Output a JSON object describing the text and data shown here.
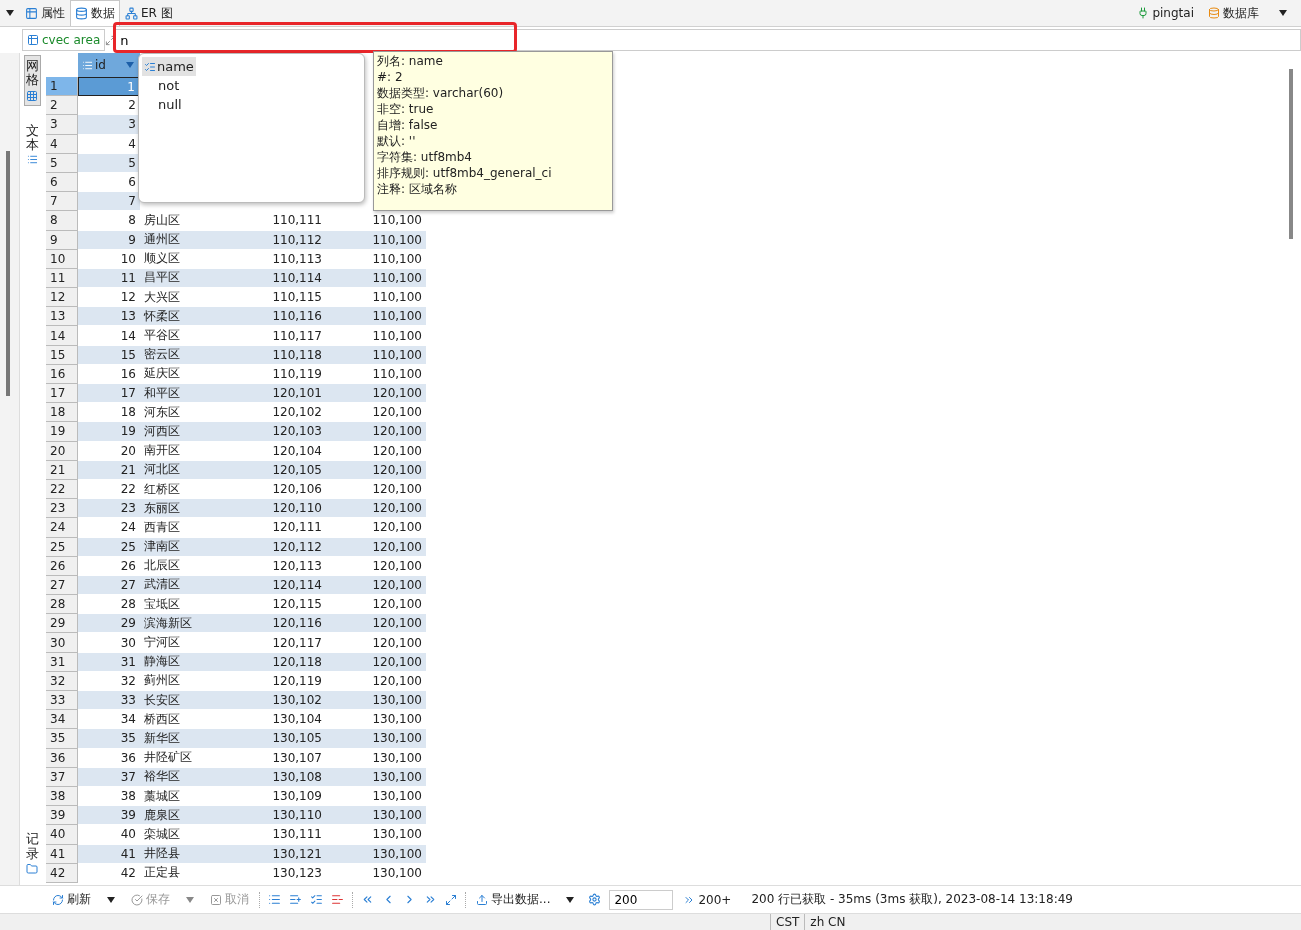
{
  "tabs": [
    {
      "label": "属性",
      "selected": false,
      "kind": "props"
    },
    {
      "label": "数据",
      "selected": true,
      "kind": "data"
    },
    {
      "label": "ER 图",
      "selected": false,
      "kind": "er"
    }
  ],
  "connection": {
    "datasource": "pingtai",
    "database": "数据库"
  },
  "filter": {
    "table": "cvec area",
    "value": "n",
    "highlighted": true
  },
  "side_tabs": [
    {
      "label": "网格",
      "selected": true,
      "kind": "grid"
    },
    {
      "label": "文本",
      "selected": false,
      "kind": "text"
    },
    {
      "label": "记录",
      "selected": false,
      "kind": "record"
    }
  ],
  "table": {
    "columns": [
      {
        "label": "id",
        "sorted": true
      }
    ],
    "rows": [
      {
        "row_number": "1",
        "id": "1",
        "selected": true
      },
      {
        "row_number": "2",
        "id": "2",
        "selected": false
      },
      {
        "row_number": "3",
        "id": "3",
        "selected": false
      },
      {
        "row_number": "4",
        "id": "4",
        "selected": false
      },
      {
        "row_number": "5",
        "id": "5",
        "selected": false
      },
      {
        "row_number": "6",
        "id": "6",
        "selected": false
      },
      {
        "row_number": "7",
        "id": "7",
        "selected": false
      },
      {
        "row_number": "8",
        "id": "8",
        "name": "房山区",
        "column_3": "110,111",
        "column_4": "110,100",
        "selected": false
      },
      {
        "row_number": "9",
        "id": "9",
        "name": "通州区",
        "column_3": "110,112",
        "column_4": "110,100",
        "selected": false
      },
      {
        "row_number": "10",
        "id": "10",
        "name": "顺义区",
        "column_3": "110,113",
        "column_4": "110,100",
        "selected": false
      },
      {
        "row_number": "11",
        "id": "11",
        "name": "昌平区",
        "column_3": "110,114",
        "column_4": "110,100",
        "selected": false
      },
      {
        "row_number": "12",
        "id": "12",
        "name": "大兴区",
        "column_3": "110,115",
        "column_4": "110,100",
        "selected": false
      },
      {
        "row_number": "13",
        "id": "13",
        "name": "怀柔区",
        "column_3": "110,116",
        "column_4": "110,100",
        "selected": false
      },
      {
        "row_number": "14",
        "id": "14",
        "name": "平谷区",
        "column_3": "110,117",
        "column_4": "110,100",
        "selected": false
      },
      {
        "row_number": "15",
        "id": "15",
        "name": "密云区",
        "column_3": "110,118",
        "column_4": "110,100",
        "selected": false
      },
      {
        "row_number": "16",
        "id": "16",
        "name": "延庆区",
        "column_3": "110,119",
        "column_4": "110,100",
        "selected": false
      },
      {
        "row_number": "17",
        "id": "17",
        "name": "和平区",
        "column_3": "120,101",
        "column_4": "120,100",
        "selected": false
      },
      {
        "row_number": "18",
        "id": "18",
        "name": "河东区",
        "column_3": "120,102",
        "column_4": "120,100",
        "selected": false
      },
      {
        "row_number": "19",
        "id": "19",
        "name": "河西区",
        "column_3": "120,103",
        "column_4": "120,100",
        "selected": false
      },
      {
        "row_number": "20",
        "id": "20",
        "name": "南开区",
        "column_3": "120,104",
        "column_4": "120,100",
        "selected": false
      },
      {
        "row_number": "21",
        "id": "21",
        "name": "河北区",
        "column_3": "120,105",
        "column_4": "120,100",
        "selected": false
      },
      {
        "row_number": "22",
        "id": "22",
        "name": "红桥区",
        "column_3": "120,106",
        "column_4": "120,100",
        "selected": false
      },
      {
        "row_number": "23",
        "id": "23",
        "name": "东丽区",
        "column_3": "120,110",
        "column_4": "120,100",
        "selected": false
      },
      {
        "row_number": "24",
        "id": "24",
        "name": "西青区",
        "column_3": "120,111",
        "column_4": "120,100",
        "selected": false
      },
      {
        "row_number": "25",
        "id": "25",
        "name": "津南区",
        "column_3": "120,112",
        "column_4": "120,100",
        "selected": false
      },
      {
        "row_number": "26",
        "id": "26",
        "name": "北辰区",
        "column_3": "120,113",
        "column_4": "120,100",
        "selected": false
      },
      {
        "row_number": "27",
        "id": "27",
        "name": "武清区",
        "column_3": "120,114",
        "column_4": "120,100",
        "selected": false
      },
      {
        "row_number": "28",
        "id": "28",
        "name": "宝坻区",
        "column_3": "120,115",
        "column_4": "120,100",
        "selected": false
      },
      {
        "row_number": "29",
        "id": "29",
        "name": "滨海新区",
        "column_3": "120,116",
        "column_4": "120,100",
        "selected": false
      },
      {
        "row_number": "30",
        "id": "30",
        "name": "宁河区",
        "column_3": "120,117",
        "column_4": "120,100",
        "selected": false
      },
      {
        "row_number": "31",
        "id": "31",
        "name": "静海区",
        "column_3": "120,118",
        "column_4": "120,100",
        "selected": false
      },
      {
        "row_number": "32",
        "id": "32",
        "name": "蓟州区",
        "column_3": "120,119",
        "column_4": "120,100",
        "selected": false
      },
      {
        "row_number": "33",
        "id": "33",
        "name": "长安区",
        "column_3": "130,102",
        "column_4": "130,100",
        "selected": false
      },
      {
        "row_number": "34",
        "id": "34",
        "name": "桥西区",
        "column_3": "130,104",
        "column_4": "130,100",
        "selected": false
      },
      {
        "row_number": "35",
        "id": "35",
        "name": "新华区",
        "column_3": "130,105",
        "column_4": "130,100",
        "selected": false
      },
      {
        "row_number": "36",
        "id": "36",
        "name": "井陉矿区",
        "column_3": "130,107",
        "column_4": "130,100",
        "selected": false
      },
      {
        "row_number": "37",
        "id": "37",
        "name": "裕华区",
        "column_3": "130,108",
        "column_4": "130,100",
        "selected": false
      },
      {
        "row_number": "38",
        "id": "38",
        "name": "藁城区",
        "column_3": "130,109",
        "column_4": "130,100",
        "selected": false
      },
      {
        "row_number": "39",
        "id": "39",
        "name": "鹿泉区",
        "column_3": "130,110",
        "column_4": "130,100",
        "selected": false
      },
      {
        "row_number": "40",
        "id": "40",
        "name": "栾城区",
        "column_3": "130,111",
        "column_4": "130,100",
        "selected": false
      },
      {
        "row_number": "41",
        "id": "41",
        "name": "井陉县",
        "column_3": "130,121",
        "column_4": "130,100",
        "selected": false
      },
      {
        "row_number": "42",
        "id": "42",
        "name": "正定县",
        "column_3": "130,123",
        "column_4": "130,100",
        "selected": false
      }
    ]
  },
  "autocomplete": {
    "items": [
      {
        "label": "name",
        "selected": true,
        "kind": "column"
      },
      {
        "label": "not",
        "selected": false,
        "kind": "keyword"
      },
      {
        "label": "null",
        "selected": false,
        "kind": "keyword"
      }
    ]
  },
  "tooltip": {
    "lines": [
      "列名: name",
      "#: 2",
      "数据类型: varchar(60)",
      "非空: true",
      "自增: false",
      "默认: ''",
      "字符集: utf8mb4",
      "排序规则: utf8mb4_general_ci",
      "注释: 区域名称"
    ]
  },
  "toolbar": {
    "refresh": "刷新",
    "save": {
      "label": "保存",
      "disabled": true
    },
    "cancel": {
      "label": "取消",
      "disabled": true
    },
    "export": "导出数据...",
    "fetch_size": "200",
    "fetch_more": "200+",
    "message": "200 行已获取 - 35ms (3ms 获取), 2023-08-14 13:18:49"
  },
  "status_bar": [
    "CST",
    "zh CN"
  ]
}
